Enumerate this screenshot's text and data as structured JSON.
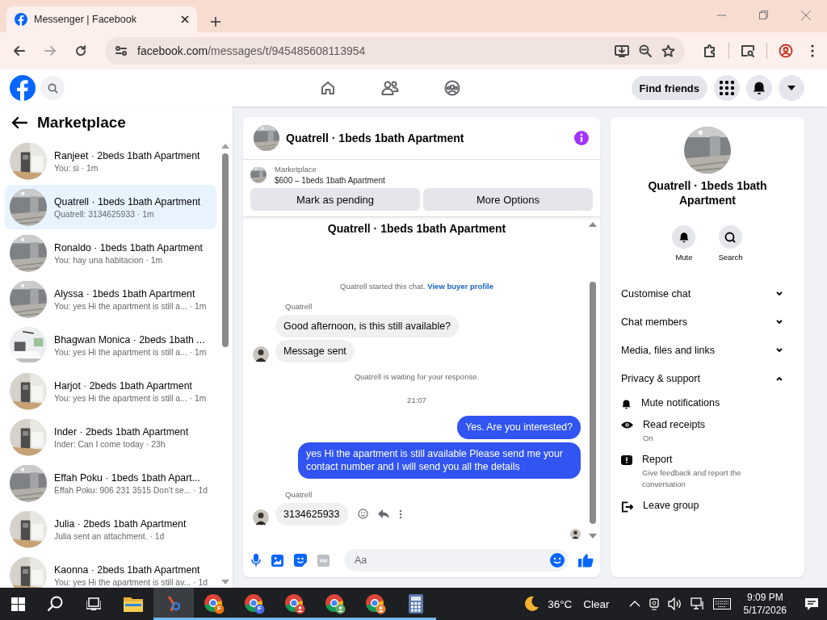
{
  "browser": {
    "tab": {
      "title": "Messenger | Facebook"
    },
    "address": {
      "host": "facebook.com",
      "path": "/messages/t/945485608113954"
    }
  },
  "topbar": {
    "find_friends": "Find friends"
  },
  "sidebar": {
    "title": "Marketplace",
    "conversations": [
      {
        "name": "Ranjeet · 2beds 1bath Apartment",
        "preview": "You: si",
        "time": "· 1m",
        "selected": false
      },
      {
        "name": "Quatrell · 1beds 1bath Apartment",
        "preview": "Quatrell: 3134625933",
        "time": "· 1m",
        "selected": true
      },
      {
        "name": "Ronaldo · 1beds 1bath Apartment",
        "preview": "You: hay una habitacion",
        "time": "· 1m",
        "selected": false
      },
      {
        "name": "Alyssa · 1beds 1bath Apartment",
        "preview": "You: yes Hi the apartment is still a...",
        "time": "· 1m",
        "selected": false
      },
      {
        "name": "Bhagwan Monica · 2beds 1bath ...",
        "preview": "You: yes Hi the apartment is still a...",
        "time": "· 1m",
        "selected": false
      },
      {
        "name": "Harjot · 2beds 1bath Apartment",
        "preview": "You: yes Hi the apartment is still a...",
        "time": "· 1m",
        "selected": false
      },
      {
        "name": "Inder · 2beds 1bath Apartment",
        "preview": "Inder: Can I come today",
        "time": "· 23h",
        "selected": false
      },
      {
        "name": "Effah Poku · 1beds 1bath Apart...",
        "preview": "Effah Poku: 906 231 3515 Don't se...",
        "time": "· 1d",
        "selected": false
      },
      {
        "name": "Julia · 2beds 1bath Apartment",
        "preview": "Julia sent an attachment.",
        "time": "· 1d",
        "selected": false
      },
      {
        "name": "Kaonna · 2beds 1bath Apartment",
        "preview": "You: yes Hi the apartment is still av...",
        "time": "· 1d",
        "selected": false
      }
    ]
  },
  "chat": {
    "title": "Quatrell · 1beds 1bath Apartment",
    "listing": {
      "label": "Marketplace",
      "price_line": "$600 – 1beds 1bath Apartment"
    },
    "actions": [
      "Mark as pending",
      "More Options"
    ],
    "messages": [
      {
        "kind": "heading",
        "text": "Quatrell · 1beds 1bath Apartment"
      },
      {
        "kind": "note",
        "text": "Quatrell started this chat.",
        "link": "View buyer profile"
      },
      {
        "kind": "sender",
        "text": "Quatrell"
      },
      {
        "kind": "incoming",
        "text": "Good afternoon, is this still available?",
        "hover_actions": false
      },
      {
        "kind": "incoming",
        "text": "Message sent",
        "hover_actions": false
      },
      {
        "kind": "note",
        "text": "Quatrell is waiting for your response."
      },
      {
        "kind": "time",
        "text": "21:07"
      },
      {
        "kind": "outgoing",
        "text": "Yes. Are you interested?"
      },
      {
        "kind": "outgoing",
        "text": "yes Hi the apartment is still available Please send me your contact number and I will send you all the details"
      },
      {
        "kind": "sender",
        "text": "Quatrell"
      },
      {
        "kind": "incoming",
        "text": "3134625933",
        "hover_actions": true
      },
      {
        "kind": "seen"
      }
    ],
    "composer": {
      "placeholder": "Aa"
    }
  },
  "details": {
    "name": "Quatrell · 1beds 1bath Apartment",
    "quick_actions": [
      {
        "kind": "mute",
        "label": "Mute"
      },
      {
        "kind": "search",
        "label": "Search"
      }
    ],
    "sections": [
      {
        "title": "Customise chat",
        "expanded": false
      },
      {
        "title": "Chat members",
        "expanded": false
      },
      {
        "title": "Media, files and links",
        "expanded": false
      },
      {
        "title": "Privacy & support",
        "expanded": true,
        "items": [
          {
            "kind": "bell",
            "label": "Mute notifications"
          },
          {
            "kind": "eye",
            "label": "Read receipts",
            "detail": "On"
          },
          {
            "kind": "report",
            "label": "Report",
            "detail": "Give feedback and report the conversation"
          },
          {
            "kind": "leave",
            "label": "Leave group"
          }
        ]
      }
    ]
  },
  "taskbar": {
    "apps": [
      {
        "kind": "explorer",
        "running": false,
        "selected": false
      },
      {
        "kind": "tool",
        "running": true,
        "selected": true
      },
      {
        "kind": "chrome",
        "badge": "F",
        "color": "#e8710a",
        "running": true,
        "selected": false
      },
      {
        "kind": "chrome",
        "badge": "F",
        "color": "#4a6ee0",
        "running": true,
        "selected": false
      },
      {
        "kind": "chrome",
        "color": "#e0483e",
        "running": true,
        "selected": false
      },
      {
        "kind": "chrome",
        "color": "#5fae6a",
        "running": true,
        "selected": false
      },
      {
        "kind": "chrome",
        "color": "#e8883a",
        "running": true,
        "selected": false
      },
      {
        "kind": "calculator",
        "running": true,
        "selected": false
      }
    ],
    "weather": {
      "temp": "36°C",
      "condition": "Clear"
    },
    "clock": {
      "time": "9:09 PM",
      "date": "5/17/2026"
    }
  }
}
